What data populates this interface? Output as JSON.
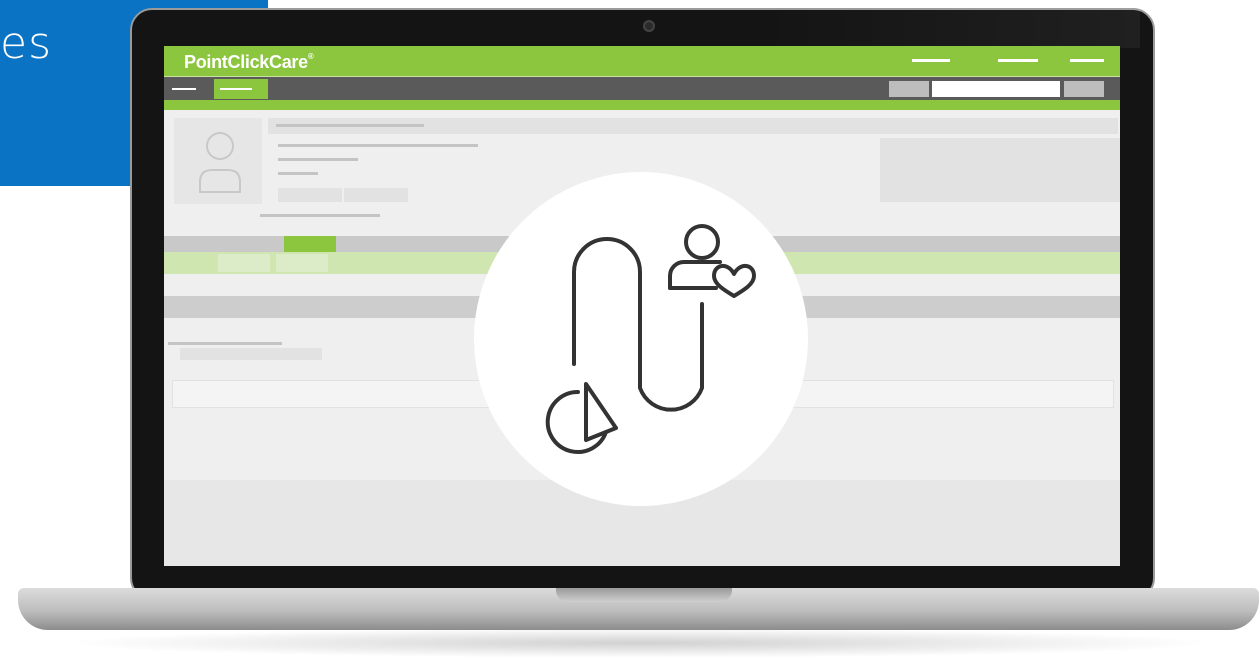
{
  "banner": {
    "partial_text": "es",
    "color": "#0a73c4"
  },
  "app": {
    "brand_name": "PointClickCare",
    "brand_mark": "®",
    "brand_color": "#8cc63f",
    "nav_color": "#5a5a5a"
  },
  "overlay": {
    "icon_name": "care-journey-icon",
    "icon_parts": [
      "person-icon",
      "heart-icon",
      "pie-chart-icon"
    ]
  }
}
